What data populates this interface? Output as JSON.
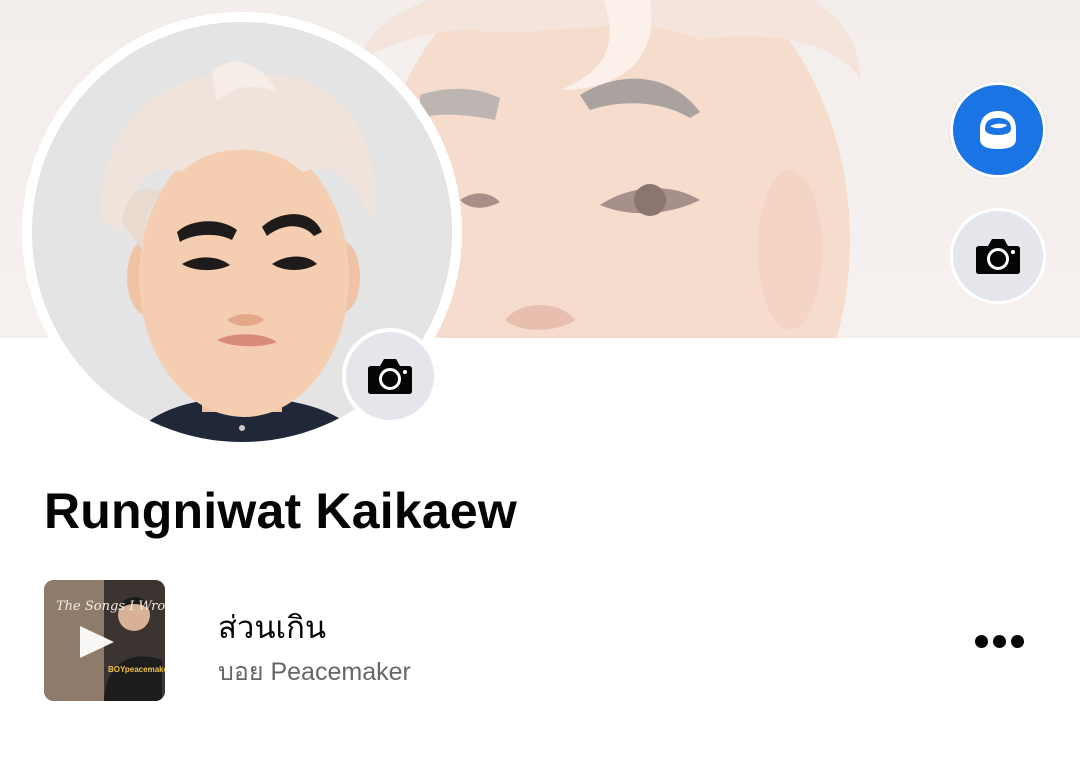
{
  "profile": {
    "name": "Rungniwat Kaikaew"
  },
  "cover": {
    "camera_icon": "camera-icon"
  },
  "avatar": {
    "camera_icon": "camera-icon"
  },
  "actions": {
    "avatar_button_icon": "avatar-face-icon",
    "avatar_button_color": "#1b74e4",
    "cover_camera_icon": "camera-icon"
  },
  "music": {
    "title": "ส่วนเกิน",
    "artist": "บอย Peacemaker",
    "album_art_text": "The Songs I Wrote",
    "album_art_label": "BOYpeacemaker",
    "play_icon": "play-icon",
    "more_icon": "more-dots-icon"
  }
}
